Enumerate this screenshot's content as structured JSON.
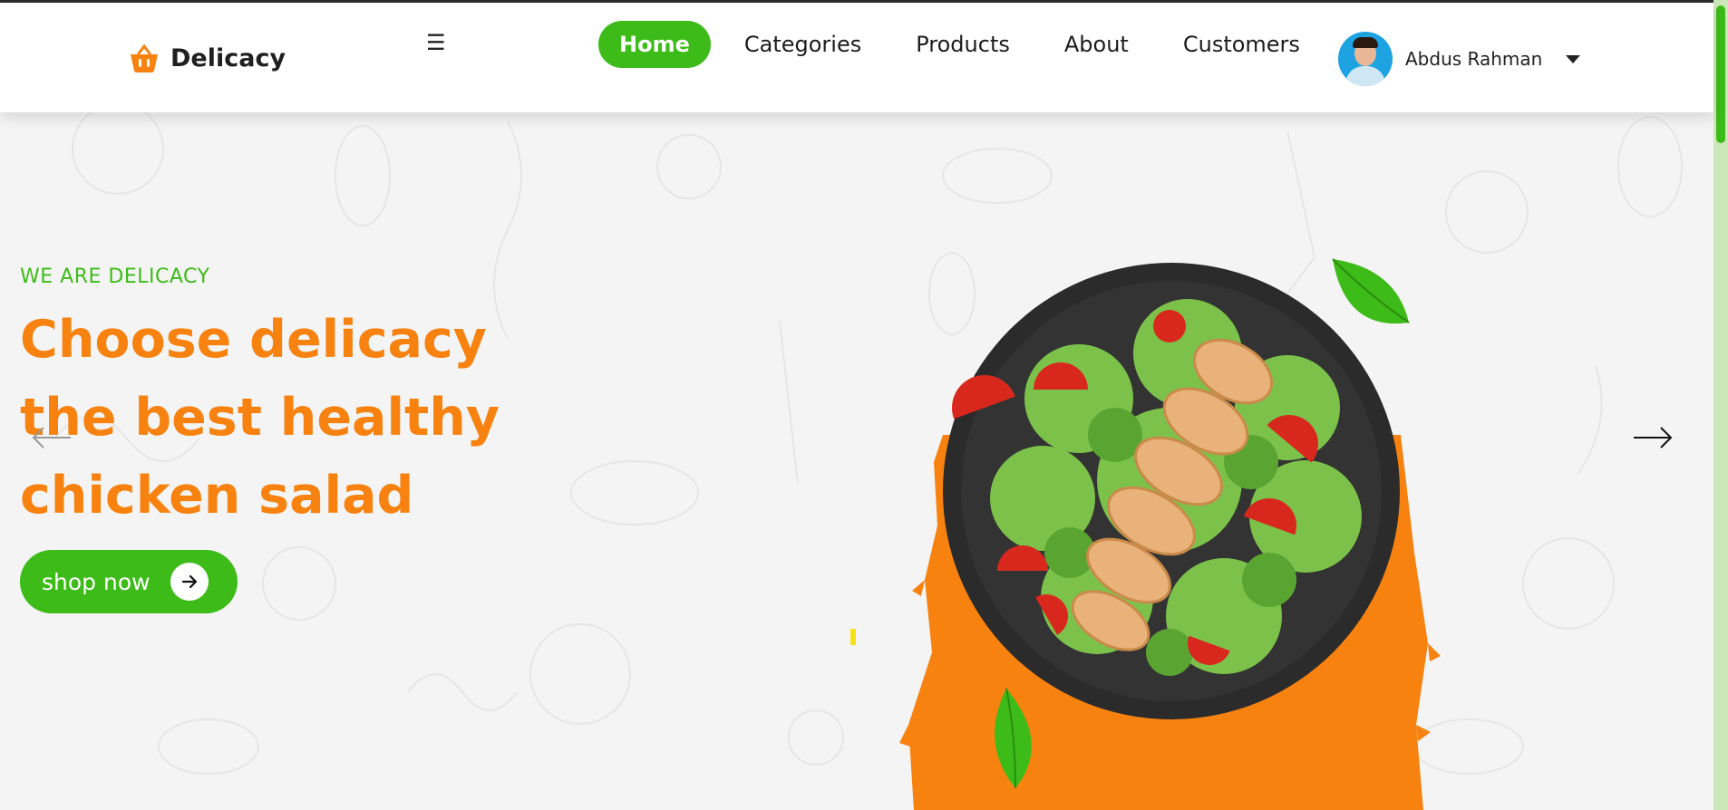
{
  "brand": {
    "name": "Delicacy",
    "icon": "basket-icon",
    "color": "#f7820f"
  },
  "nav": {
    "menu_icon": "hamburger-icon",
    "items": [
      {
        "label": "Home",
        "active": true
      },
      {
        "label": "Categories",
        "active": false
      },
      {
        "label": "Products",
        "active": false
      },
      {
        "label": "About",
        "active": false
      },
      {
        "label": "Customers",
        "active": false
      }
    ]
  },
  "user": {
    "name": "Abdus Rahman",
    "dropdown_icon": "caret-down-icon"
  },
  "hero": {
    "tagline": "WE ARE DELICACY",
    "headline": "Choose delicacy the best healthy chicken salad",
    "cta": {
      "label": "shop now",
      "icon": "arrow-right-icon"
    },
    "prev_icon": "arrow-left-icon",
    "next_icon": "arrow-right-icon",
    "image": "chicken-salad-plate"
  },
  "colors": {
    "accent_green": "#3dbb18",
    "accent_orange": "#f7820f",
    "background": "#f4f4f4"
  }
}
